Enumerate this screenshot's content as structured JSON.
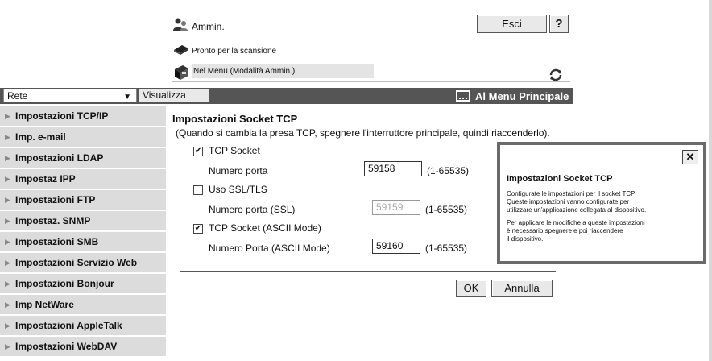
{
  "header": {
    "user_label": "Ammin.",
    "logout_label": "Esci",
    "help_label": "?",
    "status_ready": "Pronto per la scansione",
    "status_mode": "Nel Menu (Modalità Ammin.)"
  },
  "navbar": {
    "category_value": "Rete",
    "view_label": "Visualizza",
    "main_menu_label": "Al Menu Principale"
  },
  "sidebar": {
    "items": [
      {
        "label": "Impostazioni TCP/IP"
      },
      {
        "label": "Imp. e-mail"
      },
      {
        "label": "Impostazioni LDAP"
      },
      {
        "label": "Impostaz IPP"
      },
      {
        "label": "Impostazioni FTP"
      },
      {
        "label": "Impostaz. SNMP"
      },
      {
        "label": "Impostazioni SMB"
      },
      {
        "label": "Impostazioni Servizio Web"
      },
      {
        "label": "Impostazioni Bonjour"
      },
      {
        "label": "Imp NetWare"
      },
      {
        "label": "Impostazioni AppleTalk"
      },
      {
        "label": "Impostazioni WebDAV"
      }
    ]
  },
  "main": {
    "title": "Impostazioni Socket TCP",
    "note": "(Quando si cambia la presa TCP, spegnere l'interruttore principale, quindi riaccenderlo).",
    "tcp_socket": {
      "label": "TCP Socket",
      "checked": true
    },
    "port": {
      "label": "Numero porta",
      "value": "59158",
      "range": "(1-65535)"
    },
    "ssl": {
      "label": "Uso SSL/TLS",
      "checked": false
    },
    "ssl_port": {
      "label": "Numero porta (SSL)",
      "value": "59159",
      "range": "(1-65535)"
    },
    "ascii_socket": {
      "label": "TCP Socket (ASCII Mode)",
      "checked": true
    },
    "ascii_port": {
      "label": "Numero Porta (ASCII Mode)",
      "value": "59160",
      "range": "(1-65535)"
    },
    "ok_label": "OK",
    "cancel_label": "Annulla"
  },
  "help_popup": {
    "title": "Impostazioni Socket TCP",
    "close_label": "✕",
    "line1": "Configurate le impostazioni per il socket TCP.",
    "line2": "Queste impostazioni vanno configurate per",
    "line3": "utilizzare un'applicazione collegata al dispositivo.",
    "line4": "Per applicare le modifiche a queste impostazioni",
    "line5": "è necessario spegnere e poi riaccendere",
    "line6": "il dispositivo."
  },
  "icons": {
    "user": "admin-user-icon",
    "scanner": "scanner-icon",
    "printer": "printer-icon",
    "refresh": "refresh-icon",
    "menu": "main-menu-icon"
  },
  "colors": {
    "navbar_bg": "#555555",
    "sidebar_item_bg": "#dcdcdc",
    "popup_border": "#6a6a6a"
  }
}
